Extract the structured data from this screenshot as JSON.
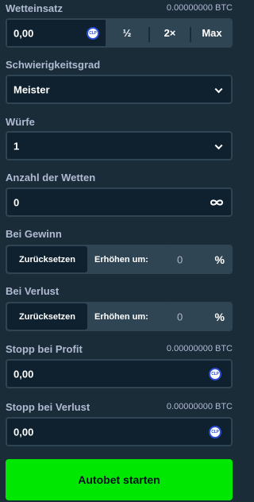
{
  "bet": {
    "label": "Wetteinsatz",
    "amount": "0.00000000 BTC",
    "value": "0,00",
    "currency_icon": "CLP",
    "half": "½",
    "double": "2×",
    "max": "Max"
  },
  "difficulty": {
    "label": "Schwierigkeitsgrad",
    "value": "Meister"
  },
  "throws": {
    "label": "Würfe",
    "value": "1"
  },
  "num_bets": {
    "label": "Anzahl der Wetten",
    "value": "0",
    "icon": "infinity-icon"
  },
  "on_win": {
    "label": "Bei Gewinn",
    "reset": "Zurücksetzen",
    "increase": "Erhöhen um:",
    "value": "0",
    "percent": "%"
  },
  "on_loss": {
    "label": "Bei Verlust",
    "reset": "Zurücksetzen",
    "increase": "Erhöhen um:",
    "value": "0",
    "percent": "%"
  },
  "stop_profit": {
    "label": "Stopp bei Profit",
    "amount": "0.00000000 BTC",
    "value": "0,00",
    "currency_icon": "CLP"
  },
  "stop_loss": {
    "label": "Stopp bei Verlust",
    "amount": "0.00000000 BTC",
    "value": "0,00",
    "currency_icon": "CLP"
  },
  "start_button": "Autobet starten",
  "colors": {
    "background": "#1a2c38",
    "input": "#0f212e",
    "border": "#2f4553",
    "label": "#b1bad3",
    "accent": "#00e701"
  }
}
